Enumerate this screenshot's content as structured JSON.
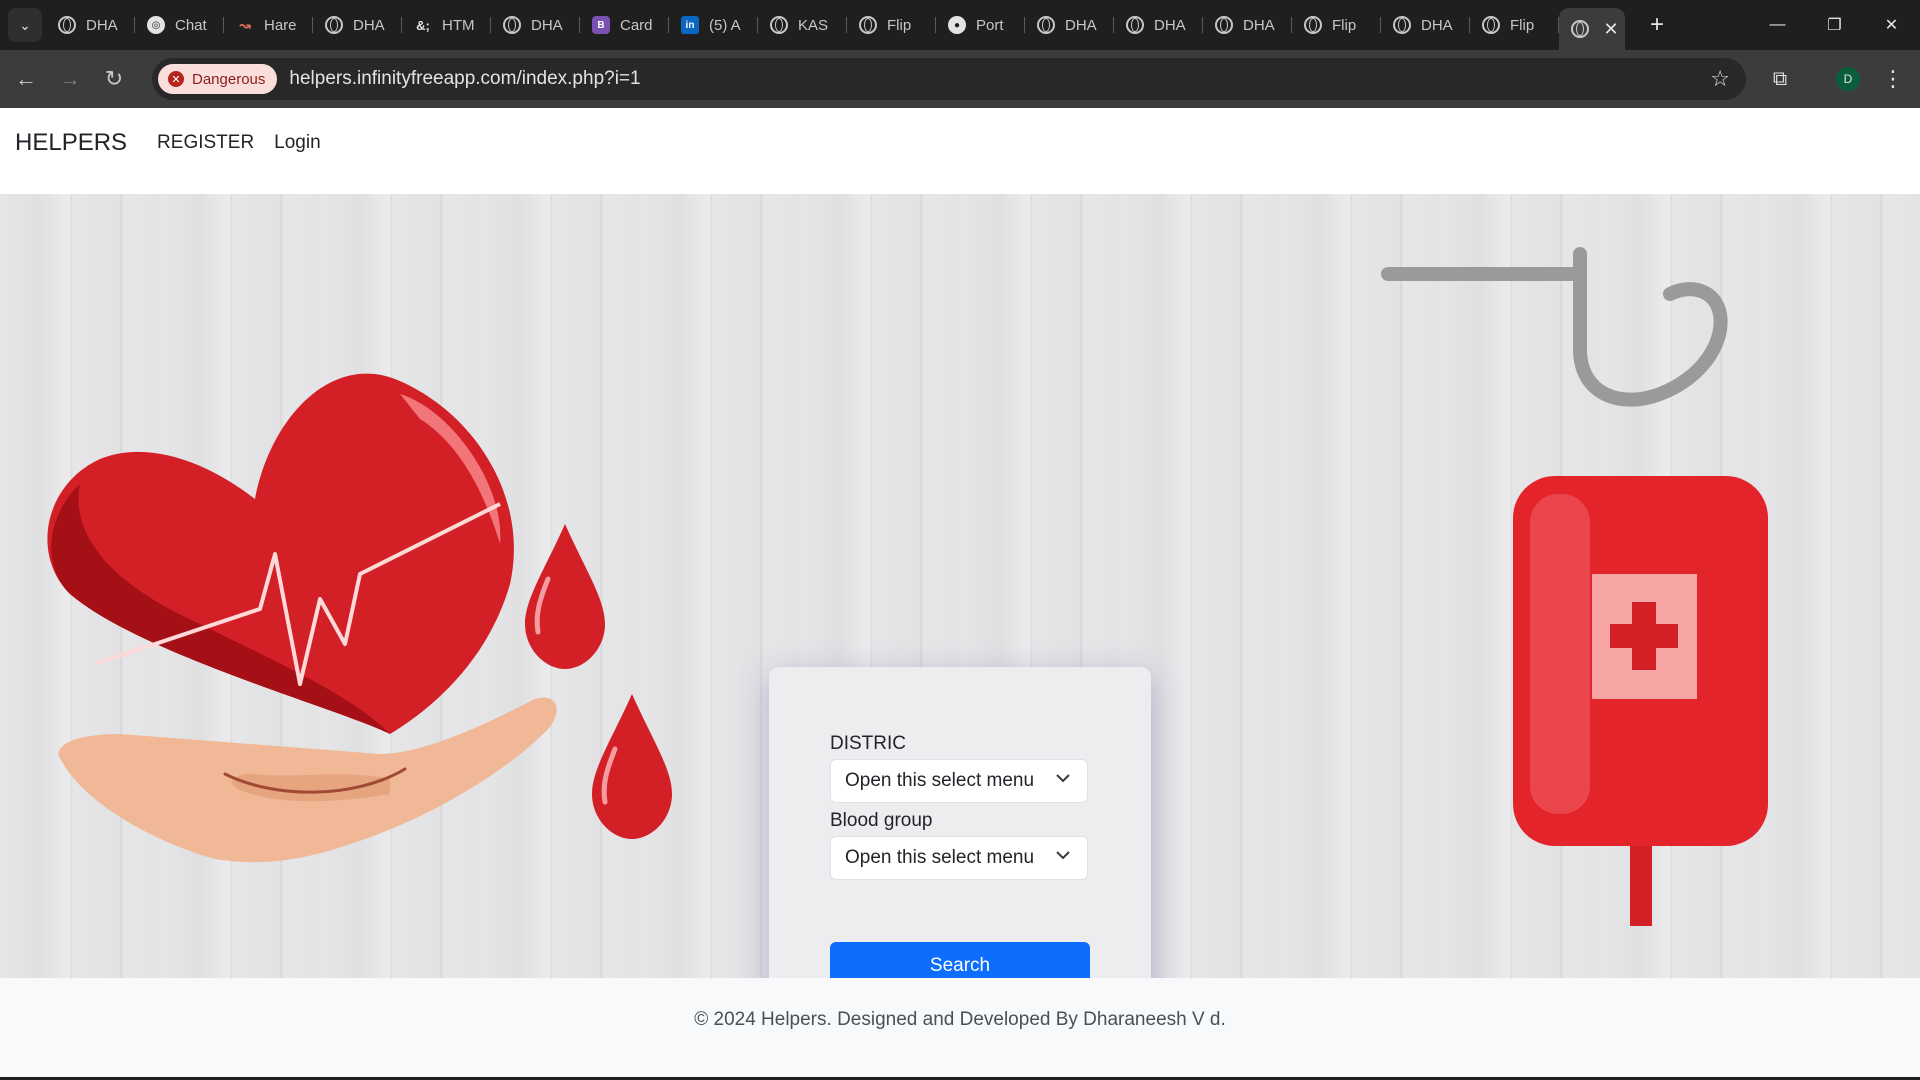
{
  "browser": {
    "tabs": [
      {
        "label": "DHA",
        "icon": "globe-icon"
      },
      {
        "label": "Chat",
        "icon": "chatgpt-icon"
      },
      {
        "label": "Hare",
        "icon": "hare-icon"
      },
      {
        "label": "DHA",
        "icon": "globe-icon"
      },
      {
        "label": "HTM",
        "icon": "html-entity-icon"
      },
      {
        "label": "DHA",
        "icon": "globe-icon"
      },
      {
        "label": "Card",
        "icon": "bootstrap-icon"
      },
      {
        "label": "(5) A",
        "icon": "linkedin-icon"
      },
      {
        "label": "KAS",
        "icon": "globe-icon"
      },
      {
        "label": "Flip",
        "icon": "globe-icon"
      },
      {
        "label": "Port",
        "icon": "github-icon"
      },
      {
        "label": "DHA",
        "icon": "globe-icon"
      },
      {
        "label": "DHA",
        "icon": "globe-icon"
      },
      {
        "label": "DHA",
        "icon": "globe-icon"
      },
      {
        "label": "Flip",
        "icon": "globe-icon"
      },
      {
        "label": "DHA",
        "icon": "globe-icon"
      },
      {
        "label": "Flip",
        "icon": "globe-icon"
      }
    ],
    "favicon_glyphs": {
      "chat": "◎",
      "hare": "↝",
      "amp": "&;",
      "boot": "B",
      "linkedin": "in",
      "github": "●"
    },
    "security_chip": "Dangerous",
    "url": "helpers.infinityfreeapp.com/index.php?i=1",
    "profile_initial": "D",
    "colors": {
      "danger_chip_bg": "#f9dedc",
      "danger_text": "#8c1d18",
      "chrome_dark": "#1f1f1f",
      "toolbar": "#3c3c3c"
    }
  },
  "navbar": {
    "brand": "HELPERS",
    "links": [
      "REGISTER",
      "Login"
    ]
  },
  "search_form": {
    "district_label": "DISTRIC",
    "district_select": "Open this select menu",
    "blood_group_label": "Blood group",
    "blood_group_select": "Open this select menu",
    "submit_label": "Search",
    "colors": {
      "primary": "#0d6efd"
    }
  },
  "footer": {
    "text": "© 2024 Helpers. Designed and Developed By Dharaneesh V d."
  }
}
